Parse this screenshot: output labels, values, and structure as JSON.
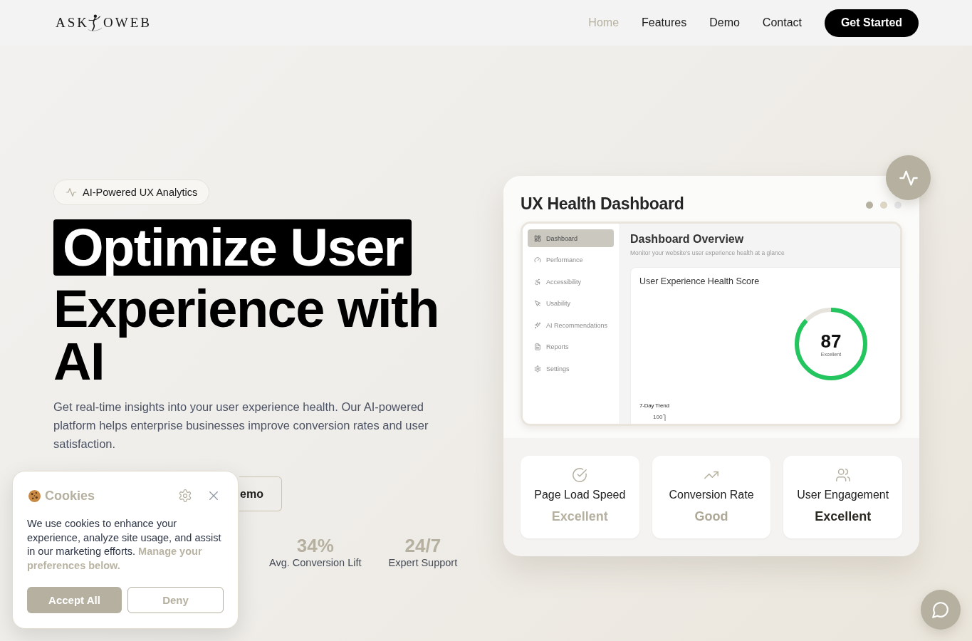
{
  "header": {
    "logo": {
      "left": "ASK",
      "right": "OWEB"
    },
    "nav": [
      {
        "label": "Home",
        "selected": true
      },
      {
        "label": "Features",
        "selected": false
      },
      {
        "label": "Demo",
        "selected": false
      },
      {
        "label": "Contact",
        "selected": false
      }
    ],
    "cta": "Get Started"
  },
  "hero": {
    "badge": "AI-Powered UX Analytics",
    "headline_highlight": "Optimize User",
    "headline": "Experience with AI",
    "description": "Get real-time insights into your user experience health. Our AI-powered platform helps enterprise businesses improve conversion rates and user satisfaction.",
    "button": "emo",
    "stats": [
      {
        "value": "34%",
        "label": "Avg. Conversion Lift"
      },
      {
        "value": "24/7",
        "label": "Expert Support"
      }
    ]
  },
  "dashboard": {
    "title": "UX Health Dashboard",
    "dots": [
      {
        "color": "#b5b09f"
      },
      {
        "color": "#ddd6c5"
      },
      {
        "color": "#e5e5e9"
      }
    ],
    "preview": {
      "sidebar": [
        {
          "label": "Dashboard",
          "selected": true
        },
        {
          "label": "Performance",
          "selected": false
        },
        {
          "label": "Accessibility",
          "selected": false
        },
        {
          "label": "Usability",
          "selected": false
        },
        {
          "label": "AI Recommendations",
          "selected": false
        },
        {
          "label": "Reports",
          "selected": false
        },
        {
          "label": "Settings",
          "selected": false
        }
      ],
      "title": "Dashboard Overview",
      "subtitle": "Monitor your website's user experience health at a glance",
      "score": {
        "title": "User Experience Health Score",
        "value": "87",
        "rating": "Excellent",
        "level": 0.87
      },
      "trend": {
        "title": "7-Day Trend",
        "tick": "100"
      }
    },
    "metrics": [
      {
        "label": "Page Load Speed",
        "status": "Excellent",
        "color": "#b5b09f"
      },
      {
        "label": "Conversion Rate",
        "status": "Good",
        "color": "#aea897"
      },
      {
        "label": "User Engagement",
        "status": "Excellent",
        "color": "#2b2922"
      }
    ]
  },
  "cookie_banner": {
    "title": "Cookies",
    "text": "We use cookies to enhance your experience, analyze site usage, and assist in our marketing efforts. **Manage your preferences below.**",
    "buttons": [
      {
        "label": "Accept All",
        "kind": "primary"
      },
      {
        "label": "Deny",
        "kind": "secondary"
      }
    ]
  }
}
